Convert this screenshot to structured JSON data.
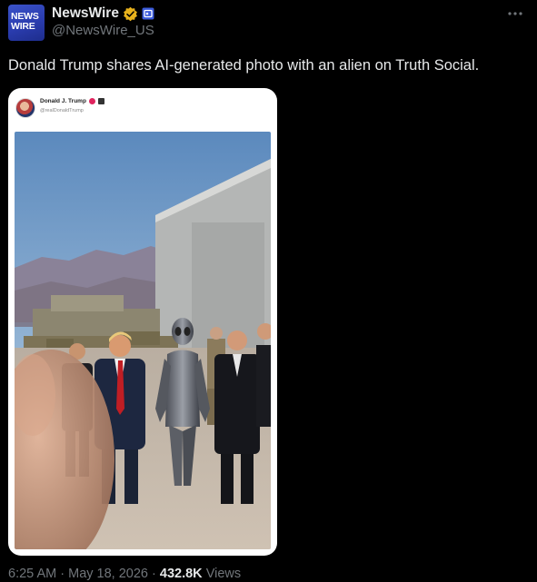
{
  "account": {
    "avatar_text": "NEWS\nWIRE",
    "display_name": "NewsWire",
    "handle": "@NewsWire_US",
    "verified_color": "#e8b21c",
    "affiliate_color": "#3b5bdb"
  },
  "tweet": {
    "text": "Donald Trump shares AI-generated photo with an alien on Truth Social."
  },
  "embedded_post": {
    "name": "Donald J. Trump",
    "handle": "@realDonaldTrump"
  },
  "meta": {
    "time": "6:25 AM",
    "separator": "·",
    "date": "May 18, 2026",
    "views_count": "432.8K",
    "views_label": "Views"
  },
  "icons": {
    "more": "more-options-icon",
    "verified": "verified-badge-icon",
    "affiliate": "affiliate-badge-icon"
  }
}
